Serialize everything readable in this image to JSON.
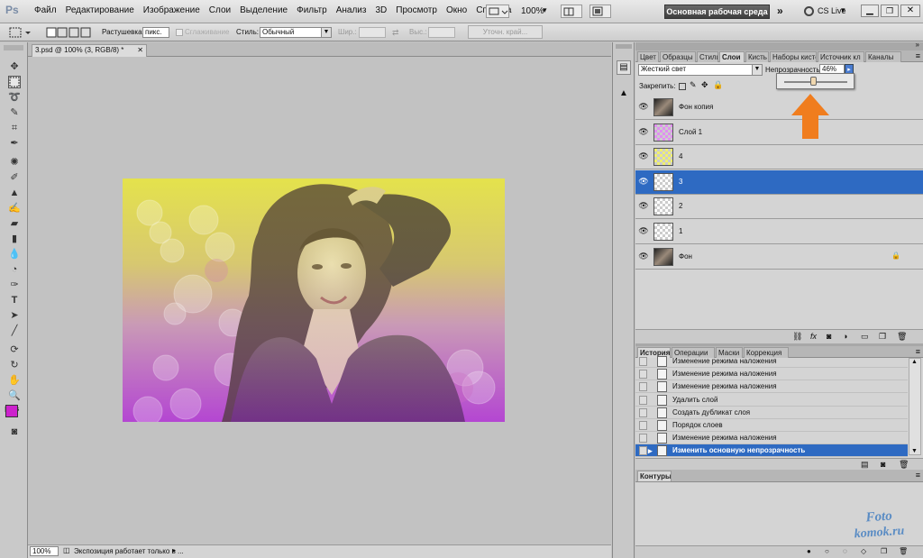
{
  "menubar": {
    "app_logo": "Ps",
    "menus": [
      "Файл",
      "Редактирование",
      "Изображение",
      "Слои",
      "Выделение",
      "Фильтр",
      "Анализ",
      "3D",
      "Просмотр",
      "Окно",
      "Справка"
    ],
    "zoom": "100%",
    "workspace": "Основная рабочая среда",
    "cs_live": "CS Live"
  },
  "options": {
    "feather_label": "Растушевка:",
    "feather_value": "пикс.",
    "antialias_label": "Сглаживание",
    "style_label": "Стиль:",
    "style_value": "Обычный",
    "width_label": "Шир.:",
    "height_label": "Выс.:",
    "refine_label": "Уточн. край..."
  },
  "document": {
    "tab_title": "3.psd @ 100% (3, RGB/8) *",
    "zoom": "100%",
    "status_text": "Экспозиция работает только в ..."
  },
  "layers_panel": {
    "tabs": [
      "Цвет",
      "Образцы",
      "Стили",
      "Слои",
      "Кисть",
      "Наборы кисте",
      "Источник кл",
      "Каналы"
    ],
    "active_tab": "Слои",
    "blend_mode": "Жесткий свет",
    "opacity_label": "Непрозрачность:",
    "opacity_value": "46%",
    "opacity_slider_percent": 46,
    "lock_label": "Закрепить:",
    "layers": [
      {
        "name": "Фон копия",
        "thumb": "photo",
        "selected": false
      },
      {
        "name": "Слой 1",
        "thumb": "violet",
        "selected": false
      },
      {
        "name": "4",
        "thumb": "yellow",
        "selected": false
      },
      {
        "name": "3",
        "thumb": "empty",
        "selected": true
      },
      {
        "name": "2",
        "thumb": "empty",
        "selected": false
      },
      {
        "name": "1",
        "thumb": "empty",
        "selected": false
      },
      {
        "name": "Фон",
        "thumb": "photo",
        "selected": false,
        "locked": true
      }
    ]
  },
  "history_panel": {
    "tabs": [
      "История",
      "Операции",
      "Маски",
      "Коррекция"
    ],
    "active_tab": "История",
    "items": [
      {
        "name": "Изменение режима наложения",
        "selected": false
      },
      {
        "name": "Изменение режима наложения",
        "selected": false
      },
      {
        "name": "Изменение режима наложения",
        "selected": false
      },
      {
        "name": "Удалить слой",
        "selected": false
      },
      {
        "name": "Создать дубликат слоя",
        "selected": false
      },
      {
        "name": "Порядок слоев",
        "selected": false
      },
      {
        "name": "Изменение режима наложения",
        "selected": false
      },
      {
        "name": "Изменить основную непрозрачность",
        "selected": true
      }
    ]
  },
  "paths_panel": {
    "tab": "Контуры"
  },
  "watermark": {
    "line1": "Foto",
    "line2": "komok.ru"
  },
  "colors": {
    "accent_selection": "#2e6ac2",
    "foreground_color": "#cc22cc",
    "background_color": "#ffffff",
    "arrow": "#f07d1e"
  }
}
